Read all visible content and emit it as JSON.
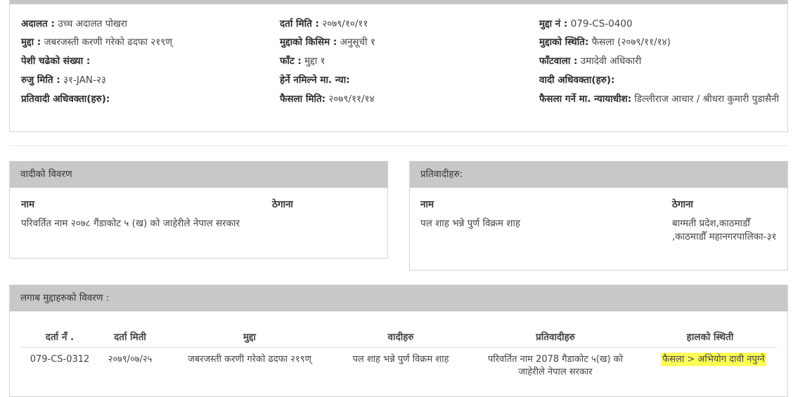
{
  "case_info": {
    "court_label": "अदालत :",
    "court_value": "उच्च अदालत पोखरा",
    "reg_date_label": "दर्ता मिति :",
    "reg_date_value": "२०७९/१०/११",
    "case_no_label": "मुद्दा नं :",
    "case_no_value": "079-CS-0400",
    "case_label": "मुद्दा :",
    "case_value": "जबरजस्ती करणी गरेको ढदफा २१९ण्",
    "case_type_label": "मुद्दाको किसिम :",
    "case_type_value": "अनुसूची १",
    "case_status_label": "मुद्दाको स्थिति:",
    "case_status_value": "फैसला (२०७९/११/१४)",
    "hearing_count_label": "पेशी चढेको संख्या :",
    "hearing_count_value": "",
    "faat_label": "फाँट :",
    "faat_value": "मुद्दा १",
    "faatwala_label": "फाँटवाला :",
    "faatwala_value": "उमादेवी अधिकारी",
    "filed_date_label": "रुजु मिति :",
    "filed_date_value": "३१-JAN-२३",
    "judge_label": "हेर्ने नमिल्ने मा. न्या:",
    "judge_value": "",
    "plaintiff_lawyer_label": "वादी अधिवक्ता(हरु):",
    "plaintiff_lawyer_value": "",
    "defendant_lawyer_label": "प्रतिवादी अधिवक्ता(हरु):",
    "defendant_lawyer_value": "",
    "verdict_date_label": "फैसला मिति:",
    "verdict_date_value": "२०७९/११/१४",
    "verdict_judge_label": "फैसला गर्ने मा. न्यायाधीश:",
    "verdict_judge_value": "डिल्लीराज आचार / श्रीधरा कुमारी पुडासैनी"
  },
  "plaintiff": {
    "title": "वादीको विवरण",
    "name_header": "नाम",
    "address_header": "ठेगाना",
    "name": "परिवर्तित नाम २०७८ गैंडाकोट ५ (ख) को जाहेरीले नेपाल सरकार",
    "address": ""
  },
  "defendant": {
    "title": "प्रतिवादीहरु:",
    "name_header": "नाम",
    "address_header": "ठेगाना",
    "name": "पल शाह भन्ने पुर्ण विक्रम शाह",
    "address": "बाग्मती प्रदेश,काठमाडौँ ,काठमाडौँ महानगरपालिका-३१"
  },
  "linked": {
    "title": "लगाब मुद्दाहरुको विवरण :",
    "headers": [
      "दर्ता नँ .",
      "दर्ता मिती",
      "मुद्दा",
      "वादीहरु",
      "प्रतिवादीहरु",
      "हालको स्थिती"
    ],
    "rows": [
      [
        "079-CS-0312",
        "२०७९/०७/२५",
        "जबरजस्ती करणी गरेको ढदफा २१९ण्",
        "पल शाह भन्ने पुर्ण विक्रम शाह",
        "परिवर्तित नाम 2078 गैडाकोट ५(ख) को जाहेरीले नेपाल सरकार",
        "फैसला > अभियोग दावी नपुग्ने"
      ]
    ]
  },
  "colors": {
    "header_bg": "#c8c8c8",
    "highlight": "#ffff55"
  }
}
